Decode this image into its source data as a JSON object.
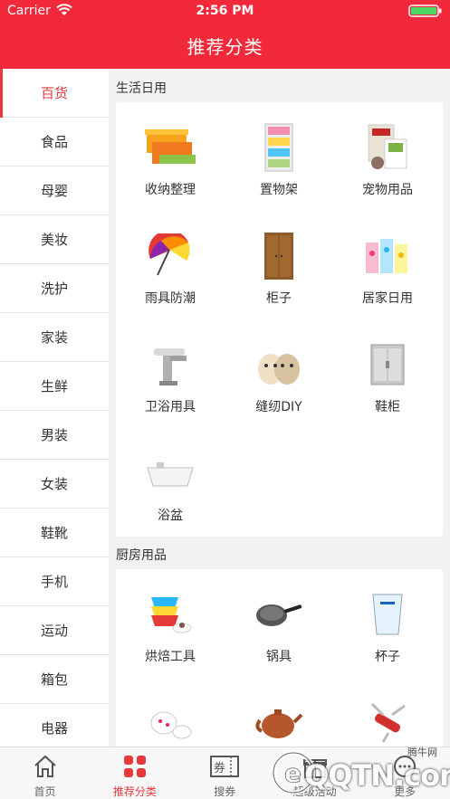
{
  "status": {
    "carrier": "Carrier",
    "time": "2:56 PM"
  },
  "nav": {
    "title": "推荐分类"
  },
  "sidebar": {
    "items": [
      {
        "label": "百货",
        "active": true
      },
      {
        "label": "食品"
      },
      {
        "label": "母婴"
      },
      {
        "label": "美妆"
      },
      {
        "label": "洗护"
      },
      {
        "label": "家装"
      },
      {
        "label": "生鲜"
      },
      {
        "label": "男装"
      },
      {
        "label": "女装"
      },
      {
        "label": "鞋靴"
      },
      {
        "label": "手机"
      },
      {
        "label": "运动"
      },
      {
        "label": "箱包"
      },
      {
        "label": "电器"
      }
    ]
  },
  "sections": [
    {
      "title": "生活日用",
      "items": [
        {
          "label": "收纳整理",
          "icon": "storage-box-icon"
        },
        {
          "label": "置物架",
          "icon": "drawer-rack-icon"
        },
        {
          "label": "宠物用品",
          "icon": "pet-supplies-icon"
        },
        {
          "label": "雨具防潮",
          "icon": "umbrella-icon"
        },
        {
          "label": "柜子",
          "icon": "wardrobe-icon"
        },
        {
          "label": "居家日用",
          "icon": "household-items-icon"
        },
        {
          "label": "卫浴用具",
          "icon": "faucet-icon"
        },
        {
          "label": "缝纫DIY",
          "icon": "plush-toy-icon"
        },
        {
          "label": "鞋柜",
          "icon": "shoe-cabinet-icon"
        },
        {
          "label": "浴盆",
          "icon": "bathtub-icon"
        }
      ]
    },
    {
      "title": "厨房用品",
      "items": [
        {
          "label": "烘焙工具",
          "icon": "baking-cups-icon"
        },
        {
          "label": "锅具",
          "icon": "frying-pan-icon"
        },
        {
          "label": "杯子",
          "icon": "glass-cup-icon"
        },
        {
          "label": "",
          "icon": "tea-set-icon"
        },
        {
          "label": "",
          "icon": "teapot-icon"
        },
        {
          "label": "",
          "icon": "swiss-knife-icon"
        }
      ]
    }
  ],
  "tabs": [
    {
      "label": "首页",
      "icon": "home-icon"
    },
    {
      "label": "推荐分类",
      "icon": "category-grid-icon",
      "active": true
    },
    {
      "label": "搜券",
      "icon": "coupon-icon"
    },
    {
      "label": "超级活动",
      "icon": "gift-icon"
    },
    {
      "label": "更多",
      "icon": "more-icon"
    }
  ],
  "watermark": {
    "text": "QQTN.com",
    "small": "腾牛网"
  },
  "colors": {
    "brand": "#f2283b",
    "active": "#e8383d"
  }
}
